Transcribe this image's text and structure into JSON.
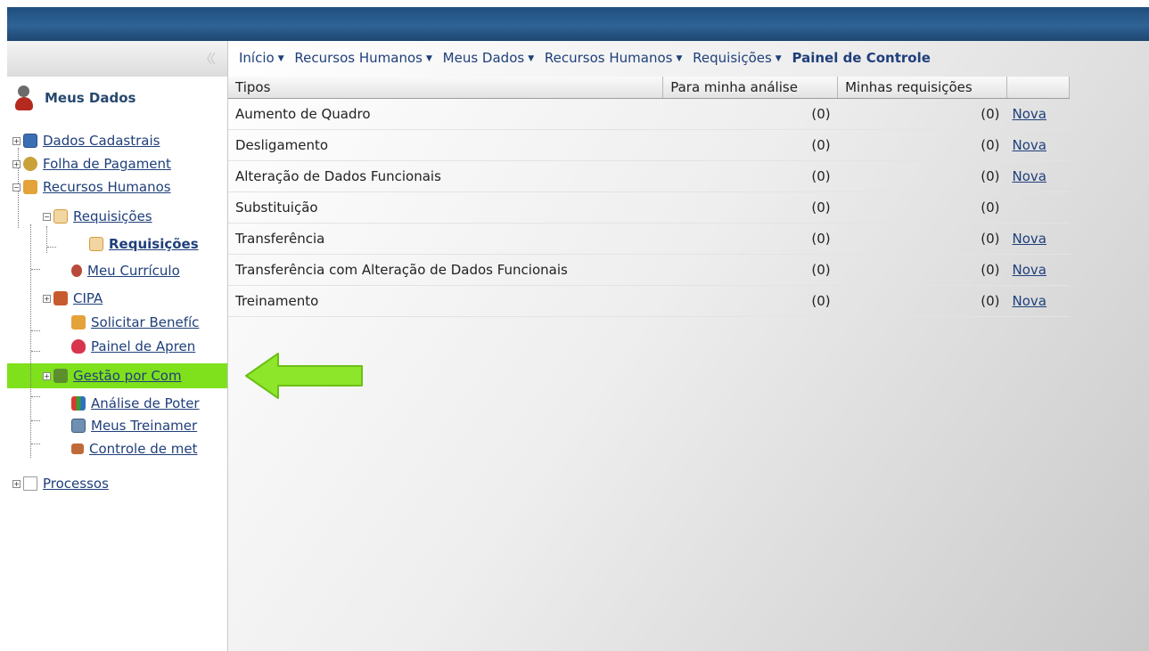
{
  "sidebar": {
    "panel_title": "Meus Dados",
    "items": [
      {
        "label": "Dados Cadastrais",
        "icon": "id-card-icon"
      },
      {
        "label": "Folha de Pagament",
        "icon": "coins-icon"
      },
      {
        "label": "Recursos Humanos",
        "icon": "people-pen-icon"
      },
      {
        "label": "Requisições",
        "icon": "document-pencil-icon"
      },
      {
        "label": "Requisições",
        "icon": "document-pencil-icon"
      },
      {
        "label": "Meu Currículo",
        "icon": "person-icon"
      },
      {
        "label": "CIPA",
        "icon": "group-icon"
      },
      {
        "label": "Solicitar Benefíc",
        "icon": "people-pen-icon"
      },
      {
        "label": "Painel de Apren",
        "icon": "heart-icon"
      },
      {
        "label": "Gestão por Com",
        "icon": "team-icon"
      },
      {
        "label": "Análise de Poter",
        "icon": "bar-chart-icon"
      },
      {
        "label": "Meus Treinamer",
        "icon": "computer-icon"
      },
      {
        "label": "Controle de met",
        "icon": "people-icon"
      },
      {
        "label": "Processos",
        "icon": "folder-icon"
      }
    ]
  },
  "breadcrumb": {
    "items": [
      "Início",
      "Recursos Humanos",
      "Meus Dados",
      "Recursos Humanos",
      "Requisições"
    ],
    "current": "Painel de Controle"
  },
  "table": {
    "headers": [
      "Tipos",
      "Para minha análise",
      "Minhas requisições",
      ""
    ],
    "rows": [
      {
        "tipo": "Aumento de Quadro",
        "analise": "(0)",
        "minhas": "(0)",
        "action": "Nova"
      },
      {
        "tipo": "Desligamento",
        "analise": "(0)",
        "minhas": "(0)",
        "action": "Nova"
      },
      {
        "tipo": "Alteração de Dados Funcionais",
        "analise": "(0)",
        "minhas": "(0)",
        "action": "Nova"
      },
      {
        "tipo": "Substituição",
        "analise": "(0)",
        "minhas": "(0)",
        "action": ""
      },
      {
        "tipo": "Transferência",
        "analise": "(0)",
        "minhas": "(0)",
        "action": "Nova"
      },
      {
        "tipo": "Transferência com Alteração de Dados Funcionais",
        "analise": "(0)",
        "minhas": "(0)",
        "action": "Nova"
      },
      {
        "tipo": "Treinamento",
        "analise": "(0)",
        "minhas": "(0)",
        "action": "Nova"
      }
    ]
  },
  "colors": {
    "header_bar": "#2f6396",
    "link": "#1f3f7a",
    "highlight": "#7fe01c",
    "arrow": "#8ee62a"
  },
  "annotation": {
    "icon": "arrow-left-icon"
  }
}
